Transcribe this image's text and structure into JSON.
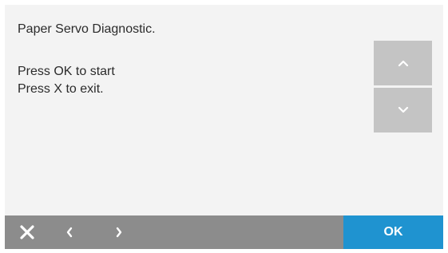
{
  "message": {
    "title": "Paper Servo Diagnostic.",
    "line1": "Press OK to start",
    "line2": "Press X to exit."
  },
  "scroll": {
    "up_icon": "chevron-up-icon",
    "down_icon": "chevron-down-icon"
  },
  "bottom_bar": {
    "exit_icon": "close-icon",
    "back_icon": "chevron-left-icon",
    "next_icon": "chevron-right-icon",
    "ok_label": "OK"
  },
  "colors": {
    "panel_bg": "#f3f3f3",
    "scroll_button_bg": "#c4c4c4",
    "bottom_bar_bg": "#8c8c8c",
    "ok_button_bg": "#1f93d0",
    "text": "#2b2b2b",
    "icon": "#ffffff"
  }
}
